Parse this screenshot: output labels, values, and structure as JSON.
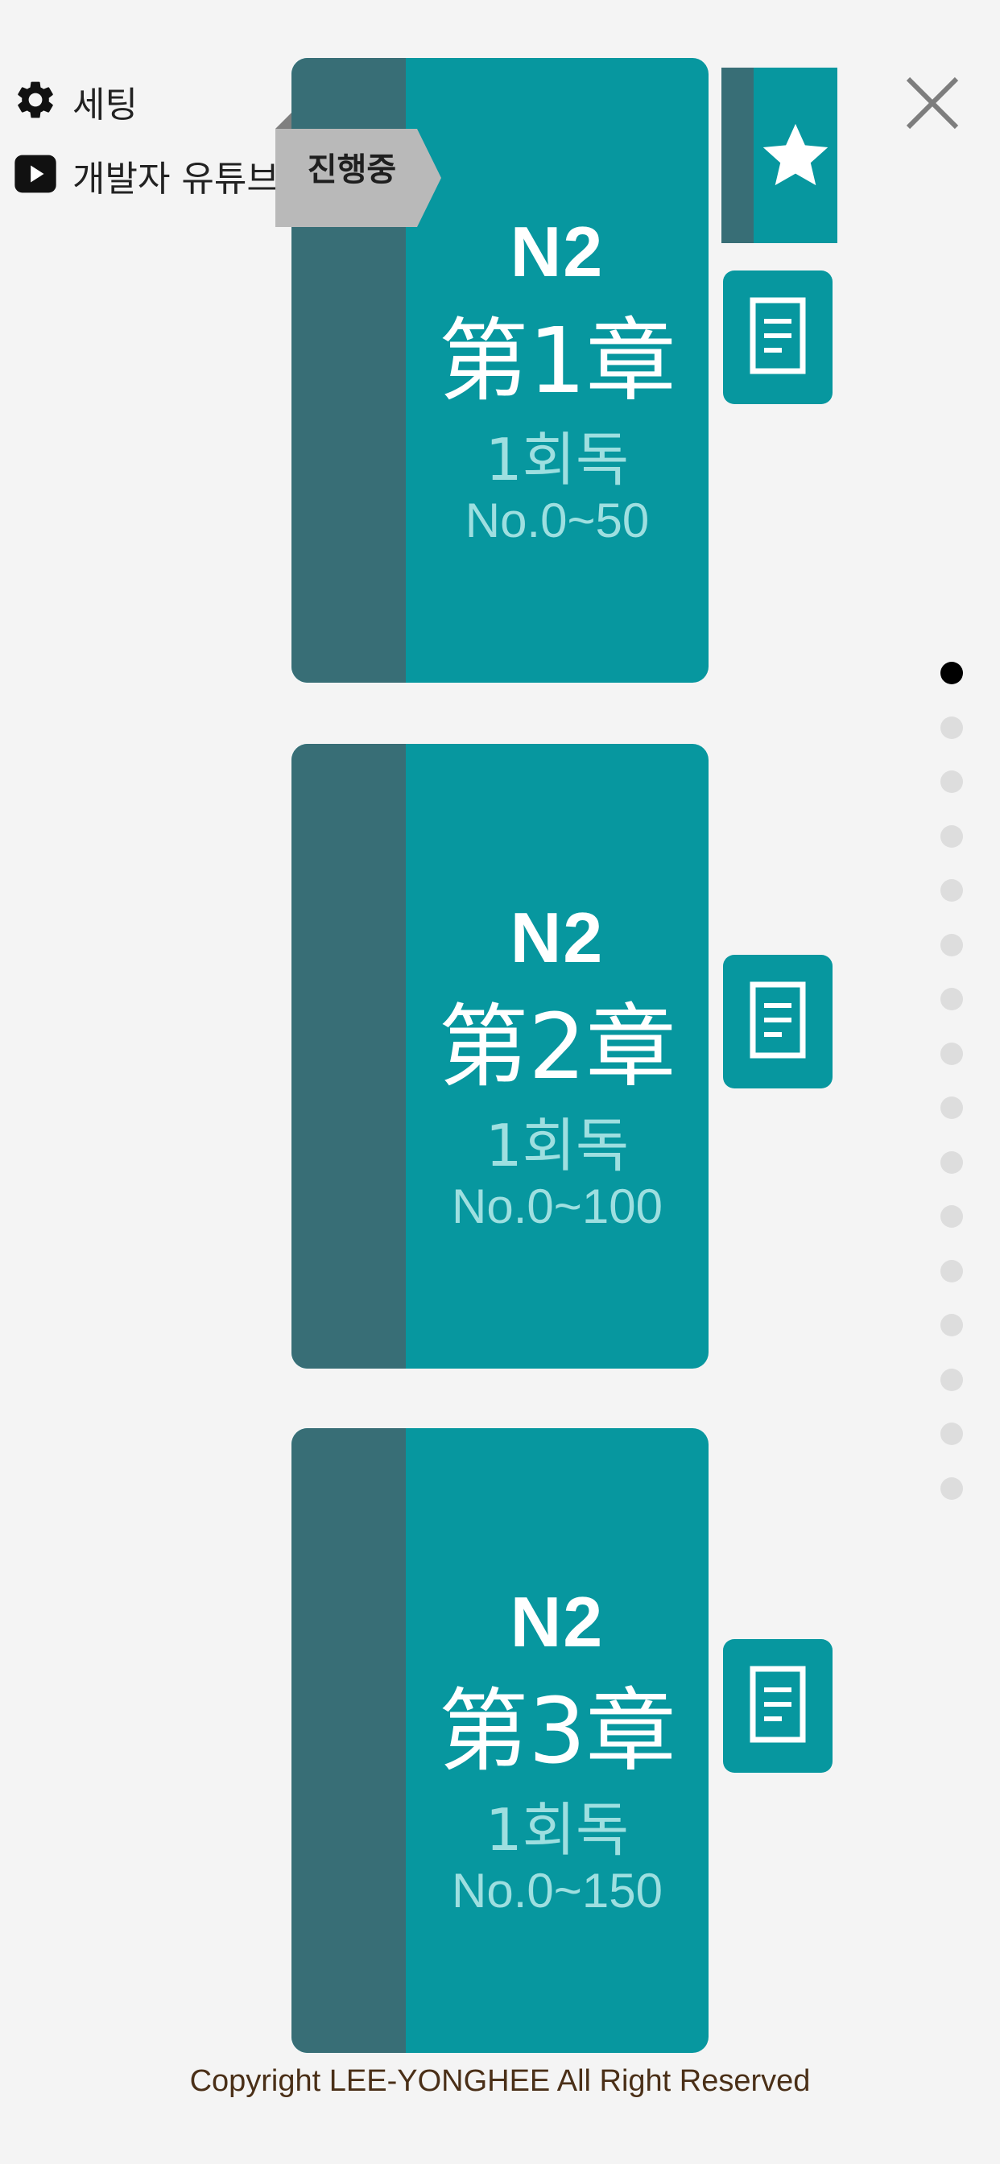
{
  "menu": {
    "settings_label": "세팅",
    "youtube_label": "개발자 유튜브"
  },
  "books": [
    {
      "level": "N2",
      "chapter": "第1章",
      "round": "1회독",
      "range": "No.0~50",
      "badge": "진행중",
      "favorite": true
    },
    {
      "level": "N2",
      "chapter": "第2章",
      "round": "1회독",
      "range": "No.0~100"
    },
    {
      "level": "N2",
      "chapter": "第3章",
      "round": "1회독",
      "range": "No.0~150"
    }
  ],
  "pager": {
    "count": 16,
    "active_index": 0
  },
  "colors": {
    "book_cover": "#07979f",
    "book_spine": "#386e76",
    "ribbon": "#b9b9b9",
    "background": "#f4f4f4"
  },
  "icons": {
    "settings": "gear-icon",
    "youtube": "play-icon",
    "close": "close-icon",
    "favorite": "star-icon",
    "memo": "document-icon"
  },
  "footer": {
    "copyright": "Copyright LEE-YONGHEE All Right Reserved"
  }
}
